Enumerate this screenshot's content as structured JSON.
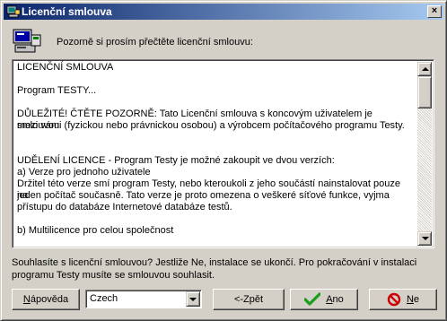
{
  "window": {
    "title": "Licenční smlouva",
    "close_glyph": "×"
  },
  "header": {
    "text": "Pozorně si prosím přečtěte licenční smlouvu:",
    "icon": "computer-setup-icon"
  },
  "license": {
    "lines": [
      "LICENČNÍ SMLOUVA",
      "",
      "Program TESTY...",
      "",
      "DŮLEŽITÉ! ČTĚTE POZORNĚ: Tato Licenční smlouva s koncovým uživatelem je smlouvou",
      "mezi vámi (fyzickou nebo právnickou osobou) a výrobcem počítačového programu Testy.",
      "",
      "",
      "UDĚLENÍ LICENCE - Program Testy je možné zakoupit ve dvou verzích:",
      "a) Verze pro jednoho uživatele",
      "Držitel této verze smí program Testy, nebo kteroukoli z jeho součástí nainstalovat pouze na",
      "jeden počítač současně. Tato verze je proto omezena o veškeré síťové funkce, vyjma",
      "přístupu do databáze Internetové databáze testů.",
      "",
      "b) Multilicence pro celou společnost"
    ]
  },
  "question": {
    "line1": "Souhlasíte s licenční smlouvou? Jestliže Ne, instalace se ukončí. Pro pokračování v instalaci",
    "line2": "programu Testy musíte se smlouvou souhlasit."
  },
  "buttons": {
    "help": {
      "pre": "",
      "accel": "N",
      "post": "ápověda"
    },
    "back": "<-Zpět",
    "yes": {
      "pre": "",
      "accel": "A",
      "post": "no"
    },
    "no": {
      "pre": "",
      "accel": "N",
      "post": "e"
    }
  },
  "language": {
    "selected": "Czech"
  },
  "colors": {
    "titlebar_start": "#0a246a",
    "titlebar_end": "#a6caf0",
    "face": "#d4d0c8",
    "check_green": "#1a9e1a",
    "no_red": "#cc0000"
  }
}
